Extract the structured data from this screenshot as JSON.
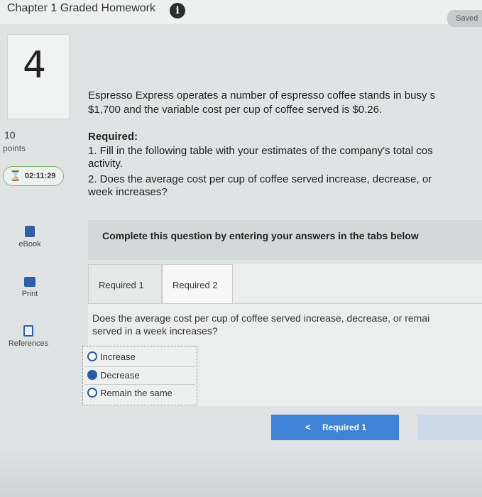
{
  "header": {
    "title": "Chapter 1 Graded Homework",
    "info_icon": "info-icon",
    "saved_label": "Saved"
  },
  "question": {
    "number": "4",
    "points_value": "10",
    "points_label": "points",
    "timer": "02:11:29"
  },
  "sidebar": {
    "items": [
      {
        "label": "eBook",
        "icon": "ebook-icon"
      },
      {
        "label": "Print",
        "icon": "print-icon"
      },
      {
        "label": "References",
        "icon": "references-icon"
      }
    ]
  },
  "problem": {
    "intro_line1": "Espresso Express operates a number of espresso coffee stands in busy s",
    "intro_line2": "$1,700 and the variable cost per cup of coffee served is $0.26.",
    "required_heading": "Required:",
    "req1_line1": "1. Fill in the following table with your estimates of the company's total cos",
    "req1_line2": "activity.",
    "req2_line1": "2. Does the average cost per cup of coffee served increase, decrease, or",
    "req2_line2": "week increases?"
  },
  "instructions": "Complete this question by entering your answers in the tabs below",
  "tabs": [
    {
      "label": "Required 1",
      "active": false
    },
    {
      "label": "Required 2",
      "active": true
    }
  ],
  "tab_content": {
    "question_line1": "Does the average cost per cup of coffee served increase, decrease, or remai",
    "question_line2": "served in a week increases?",
    "options": [
      {
        "label": "Increase",
        "selected": false
      },
      {
        "label": "Decrease",
        "selected": true
      },
      {
        "label": "Remain the same",
        "selected": false
      }
    ]
  },
  "nav": {
    "prev_label": "Required 1",
    "prev_icon": "chevron-left-icon"
  },
  "colors": {
    "accent": "#3f83d6",
    "radio": "#2a5aa6",
    "timer_border": "#7fb47a"
  }
}
